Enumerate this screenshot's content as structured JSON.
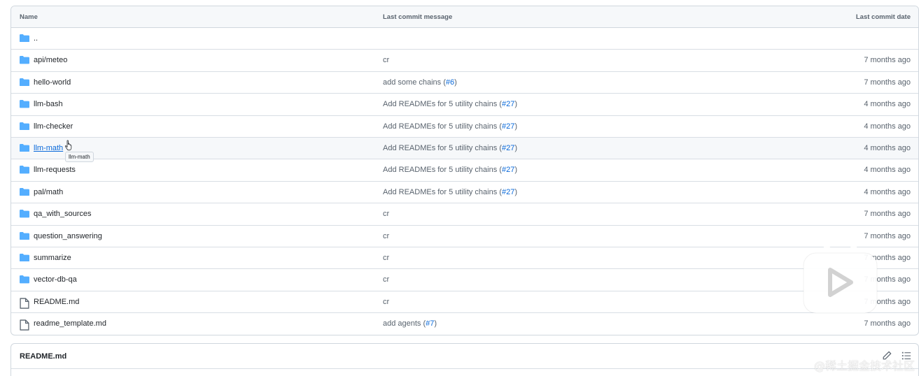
{
  "table": {
    "headers": {
      "name": "Name",
      "message": "Last commit message",
      "date": "Last commit date"
    },
    "rows": [
      {
        "type": "folder",
        "name": "..",
        "message": "",
        "issue": "",
        "date": ""
      },
      {
        "type": "folder",
        "name": "api/meteo",
        "message": "cr",
        "issue": "",
        "date": "7 months ago"
      },
      {
        "type": "folder",
        "name": "hello-world",
        "message": "add some chains (",
        "issue": "#6",
        "date": "7 months ago"
      },
      {
        "type": "folder",
        "name": "llm-bash",
        "message": "Add READMEs for 5 utility chains (",
        "issue": "#27",
        "date": "4 months ago"
      },
      {
        "type": "folder",
        "name": "llm-checker",
        "message": "Add READMEs for 5 utility chains (",
        "issue": "#27",
        "date": "4 months ago"
      },
      {
        "type": "folder",
        "name": "llm-math",
        "message": "Add READMEs for 5 utility chains (",
        "issue": "#27",
        "date": "4 months ago"
      },
      {
        "type": "folder",
        "name": "llm-requests",
        "message": "Add READMEs for 5 utility chains (",
        "issue": "#27",
        "date": "4 months ago"
      },
      {
        "type": "folder",
        "name": "pal/math",
        "message": "Add READMEs for 5 utility chains (",
        "issue": "#27",
        "date": "4 months ago"
      },
      {
        "type": "folder",
        "name": "qa_with_sources",
        "message": "cr",
        "issue": "",
        "date": "7 months ago"
      },
      {
        "type": "folder",
        "name": "question_answering",
        "message": "cr",
        "issue": "",
        "date": "7 months ago"
      },
      {
        "type": "folder",
        "name": "summarize",
        "message": "cr",
        "issue": "",
        "date": "7 months ago"
      },
      {
        "type": "folder",
        "name": "vector-db-qa",
        "message": "cr",
        "issue": "",
        "date": "7 months ago"
      },
      {
        "type": "file",
        "name": "README.md",
        "message": "cr",
        "issue": "",
        "date": "7 months ago"
      },
      {
        "type": "file",
        "name": "readme_template.md",
        "message": "add agents (",
        "issue": "#7",
        "date": "7 months ago"
      }
    ],
    "tooltip": "llm-math"
  },
  "readme": {
    "title": "README.md"
  },
  "watermark": "@稀土掘金技术社区",
  "colors": {
    "folder": "#54aeff",
    "link": "#0969da",
    "muted": "#59636e",
    "border": "#d0d7de"
  },
  "icons": {
    "folder": "folder-icon",
    "file": "file-icon",
    "edit": "pencil-icon",
    "toc": "list-icon",
    "overlay": "play-icon"
  }
}
